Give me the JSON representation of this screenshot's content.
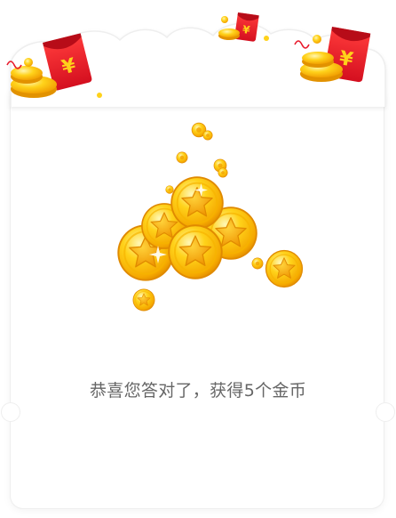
{
  "dialog": {
    "message": "恭喜您答对了，获得5个金币"
  },
  "decorations": {
    "red_envelope_symbol": "¥",
    "coin_symbol": "star",
    "icons": [
      "red-envelope-icon",
      "gold-coin-icon",
      "star-coin-icon",
      "sparkle-icon"
    ]
  },
  "colors": {
    "message_text": "#666666",
    "envelope_red": "#e8182a",
    "coin_gold": "#ffc20e",
    "coin_edge": "#e29200",
    "star_fill": "#f3a100"
  }
}
